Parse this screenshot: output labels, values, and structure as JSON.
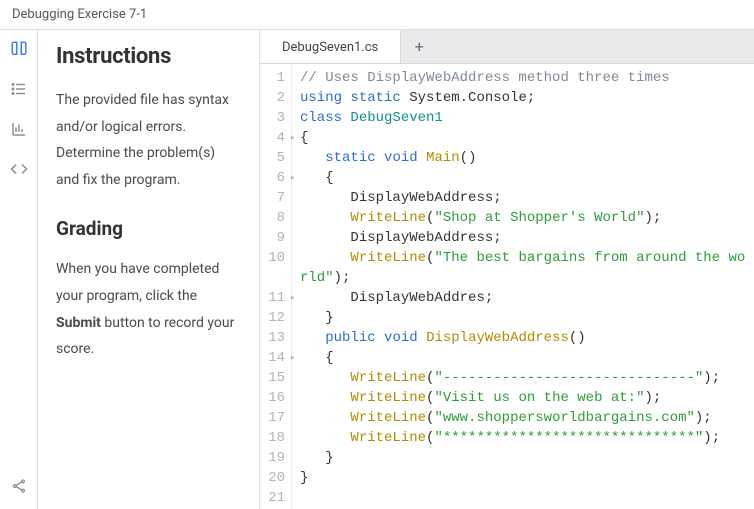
{
  "header": {
    "title": "Debugging Exercise 7-1"
  },
  "iconbar": {
    "items": [
      {
        "name": "book-icon"
      },
      {
        "name": "list-icon"
      },
      {
        "name": "chart-icon"
      },
      {
        "name": "code-icon"
      }
    ],
    "share": "share-icon"
  },
  "instructions": {
    "heading": "Instructions",
    "body": "The provided file has syntax and/or logical errors. Determine the problem(s) and fix the program.",
    "grading_heading": "Grading",
    "grading_pre": "When you have completed your program, click the ",
    "grading_bold": "Submit",
    "grading_post": " button to record your score."
  },
  "tabs": {
    "active": "DebugSeven1.cs",
    "new_label": "+"
  },
  "code": {
    "lines": [
      {
        "n": 1,
        "tokens": [
          {
            "c": "comment",
            "t": "// Uses DisplayWebAddress method three times"
          }
        ]
      },
      {
        "n": 2,
        "tokens": [
          {
            "c": "keyword",
            "t": "using"
          },
          {
            "c": "punc",
            "t": " "
          },
          {
            "c": "keyword",
            "t": "static"
          },
          {
            "c": "punc",
            "t": " "
          },
          {
            "c": "ident",
            "t": "System.Console;"
          }
        ]
      },
      {
        "n": 3,
        "tokens": [
          {
            "c": "keyword",
            "t": "class"
          },
          {
            "c": "punc",
            "t": " "
          },
          {
            "c": "type",
            "t": "DebugSeven1"
          }
        ]
      },
      {
        "n": 4,
        "caret": true,
        "tokens": [
          {
            "c": "punc",
            "t": "{"
          }
        ]
      },
      {
        "n": 5,
        "tokens": [
          {
            "c": "punc",
            "t": "   "
          },
          {
            "c": "keyword",
            "t": "static"
          },
          {
            "c": "punc",
            "t": " "
          },
          {
            "c": "keyword",
            "t": "void"
          },
          {
            "c": "punc",
            "t": " "
          },
          {
            "c": "method",
            "t": "Main"
          },
          {
            "c": "punc",
            "t": "()"
          }
        ]
      },
      {
        "n": 6,
        "caret": true,
        "tokens": [
          {
            "c": "punc",
            "t": "   {"
          }
        ]
      },
      {
        "n": 7,
        "tokens": [
          {
            "c": "punc",
            "t": "      "
          },
          {
            "c": "ident",
            "t": "DisplayWebAddress;"
          }
        ]
      },
      {
        "n": 8,
        "tokens": [
          {
            "c": "punc",
            "t": "      "
          },
          {
            "c": "method",
            "t": "WriteLine"
          },
          {
            "c": "punc",
            "t": "("
          },
          {
            "c": "string",
            "t": "\"Shop at Shopper's World\""
          },
          {
            "c": "punc",
            "t": ");"
          }
        ]
      },
      {
        "n": 9,
        "tokens": [
          {
            "c": "punc",
            "t": "      "
          },
          {
            "c": "ident",
            "t": "DisplayWebAddress;"
          }
        ]
      },
      {
        "n": 10,
        "tokens": [
          {
            "c": "punc",
            "t": "      "
          },
          {
            "c": "method",
            "t": "WriteLine"
          },
          {
            "c": "punc",
            "t": "("
          },
          {
            "c": "string",
            "t": "\"The best bargains from around the world\""
          },
          {
            "c": "punc",
            "t": ");"
          }
        ]
      },
      {
        "n": 11,
        "caret": true,
        "tokens": [
          {
            "c": "punc",
            "t": "      "
          },
          {
            "c": "ident",
            "t": "DisplayWebAddres;"
          }
        ]
      },
      {
        "n": 12,
        "tokens": [
          {
            "c": "punc",
            "t": "   }"
          }
        ]
      },
      {
        "n": 13,
        "tokens": [
          {
            "c": "punc",
            "t": "   "
          },
          {
            "c": "keyword",
            "t": "public"
          },
          {
            "c": "punc",
            "t": " "
          },
          {
            "c": "keyword",
            "t": "void"
          },
          {
            "c": "punc",
            "t": " "
          },
          {
            "c": "method",
            "t": "DisplayWebAddress"
          },
          {
            "c": "punc",
            "t": "()"
          }
        ]
      },
      {
        "n": 14,
        "caret": true,
        "tokens": [
          {
            "c": "punc",
            "t": "   {"
          }
        ]
      },
      {
        "n": 15,
        "tokens": [
          {
            "c": "punc",
            "t": "      "
          },
          {
            "c": "method",
            "t": "WriteLine"
          },
          {
            "c": "punc",
            "t": "("
          },
          {
            "c": "string",
            "t": "\"------------------------------\""
          },
          {
            "c": "punc",
            "t": ");"
          }
        ]
      },
      {
        "n": 16,
        "tokens": [
          {
            "c": "punc",
            "t": "      "
          },
          {
            "c": "method",
            "t": "WriteLine"
          },
          {
            "c": "punc",
            "t": "("
          },
          {
            "c": "string",
            "t": "\"Visit us on the web at:\""
          },
          {
            "c": "punc",
            "t": ");"
          }
        ]
      },
      {
        "n": 17,
        "tokens": [
          {
            "c": "punc",
            "t": "      "
          },
          {
            "c": "method",
            "t": "WriteLine"
          },
          {
            "c": "punc",
            "t": "("
          },
          {
            "c": "string",
            "t": "\"www.shoppersworldbargains.com\""
          },
          {
            "c": "punc",
            "t": ");"
          }
        ]
      },
      {
        "n": 18,
        "tokens": [
          {
            "c": "punc",
            "t": "      "
          },
          {
            "c": "method",
            "t": "WriteLine"
          },
          {
            "c": "punc",
            "t": "("
          },
          {
            "c": "string",
            "t": "\"******************************\""
          },
          {
            "c": "punc",
            "t": ");"
          }
        ]
      },
      {
        "n": 19,
        "tokens": [
          {
            "c": "punc",
            "t": "   }"
          }
        ]
      },
      {
        "n": 20,
        "tokens": [
          {
            "c": "punc",
            "t": "}"
          }
        ]
      },
      {
        "n": 21,
        "tokens": [
          {
            "c": "punc",
            "t": ""
          }
        ]
      }
    ]
  }
}
